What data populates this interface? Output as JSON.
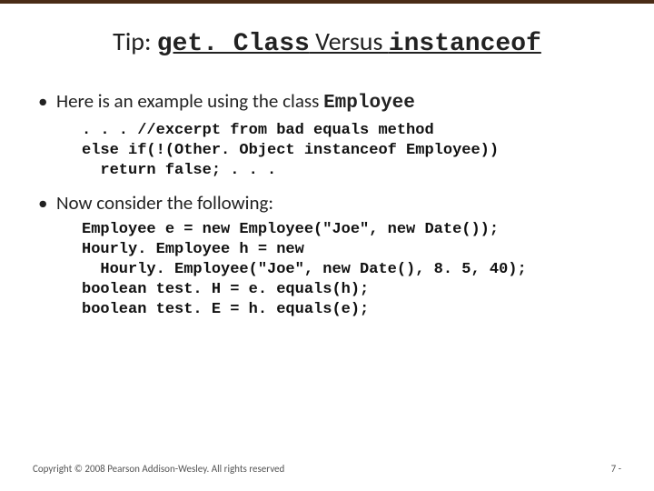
{
  "title": {
    "prefix": "Tip: ",
    "mono1": "get. Class",
    "sep": " Versus ",
    "mono2": "instanceof"
  },
  "bullets": {
    "b1_prefix": "Here is an example using the class ",
    "b1_mono": "Employee",
    "b2": "Now consider the following:"
  },
  "code": {
    "block1": ". . . //excerpt from bad equals method\nelse if(!(Other. Object instanceof Employee))\n  return false; . . .",
    "block2": "Employee e = new Employee(\"Joe\", new Date());\nHourly. Employee h = new\n  Hourly. Employee(\"Joe\", new Date(), 8. 5, 40);\nboolean test. H = e. equals(h);\nboolean test. E = h. equals(e);"
  },
  "footer": {
    "copyright": "Copyright © 2008 Pearson Addison-Wesley. All rights reserved",
    "page": "7 -"
  }
}
